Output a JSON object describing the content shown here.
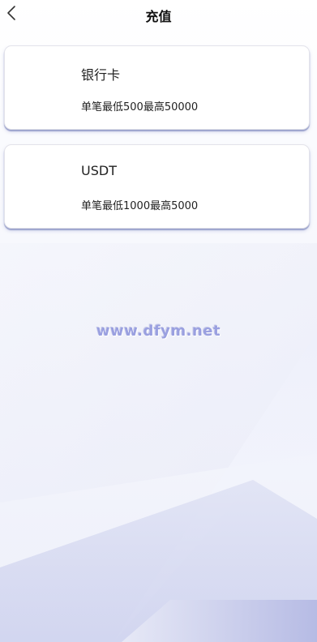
{
  "header": {
    "title": "充值",
    "back_icon": "chevron-left-icon"
  },
  "payment_methods": [
    {
      "name": "银行卡",
      "limit_text": "单笔最低500最高50000"
    },
    {
      "name": "USDT",
      "limit_text": "单笔最低1000最高5000"
    }
  ],
  "watermark": "www.dfym.net",
  "colors": {
    "card_shadow": "#9aa2cc",
    "background_accent": "#b6bbe6",
    "watermark": "#9aa0e0"
  }
}
